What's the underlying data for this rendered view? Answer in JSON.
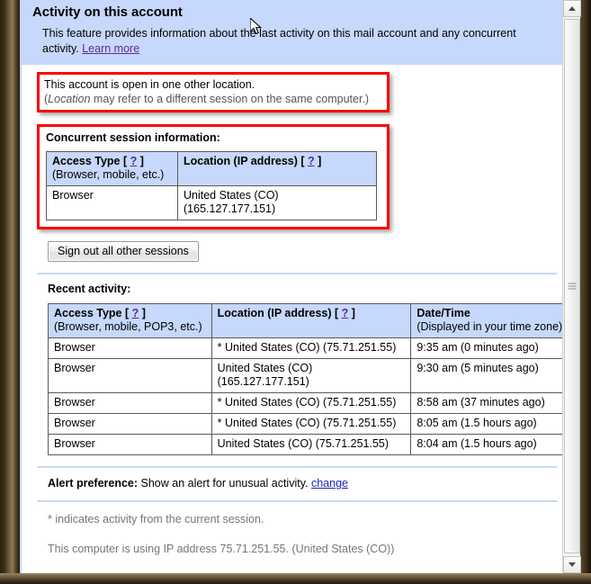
{
  "banner": {
    "title": "Activity on this account",
    "description_before_link": "This feature provides information about the last activity on this mail account and any concurrent activity. ",
    "learn_more_label": "Learn more"
  },
  "alert_box": {
    "headline": "This account is open in one other location.",
    "sub_prefix": "(",
    "sub_italic": "Location",
    "sub_rest": " may refer to a different session on the same computer.)"
  },
  "concurrent": {
    "label": "Concurrent session information:",
    "columns": [
      {
        "main": "Access Type [ ",
        "help": "?",
        "main_end": " ]",
        "sub": "(Browser, mobile, etc.)"
      },
      {
        "main": "Location (IP address) [ ",
        "help": "?",
        "main_end": " ]",
        "sub": ""
      }
    ],
    "rows": [
      {
        "access_type": "Browser",
        "location": "United States (CO) (165.127.177.151)"
      }
    ]
  },
  "signout": {
    "label": "Sign out all other sessions"
  },
  "recent": {
    "label": "Recent activity:",
    "columns": [
      {
        "main": "Access Type [ ",
        "help": "?",
        "main_end": " ]",
        "sub": "(Browser, mobile, POP3, etc.)"
      },
      {
        "main": "Location (IP address) [ ",
        "help": "?",
        "main_end": " ]",
        "sub": ""
      },
      {
        "main": "Date/Time",
        "help": "",
        "main_end": "",
        "sub": "(Displayed in your time zone)"
      }
    ],
    "rows": [
      {
        "access_type": "Browser",
        "location": "* United States (CO) (75.71.251.55)",
        "datetime": "9:35 am (0 minutes ago)"
      },
      {
        "access_type": "Browser",
        "location": "United States (CO) (165.127.177.151)",
        "datetime": "9:30 am (5 minutes ago)"
      },
      {
        "access_type": "Browser",
        "location": "* United States (CO) (75.71.251.55)",
        "datetime": "8:58 am (37 minutes ago)"
      },
      {
        "access_type": "Browser",
        "location": "* United States (CO) (75.71.251.55)",
        "datetime": "8:05 am (1.5 hours ago)"
      },
      {
        "access_type": "Browser",
        "location": "United States (CO) (75.71.251.55)",
        "datetime": "8:04 am (1.5 hours ago)"
      }
    ]
  },
  "alert_preference": {
    "label": "Alert preference:",
    "value": " Show an alert for unusual activity. ",
    "change_label": "change"
  },
  "footnotes": {
    "asterisk_note": "* indicates activity from the current session.",
    "ip_note": "This computer is using IP address 75.71.251.55. (United States (CO))"
  },
  "colors": {
    "banner_bg": "#c6d8fb",
    "table_header_bg": "#c6d8fb",
    "annotation_red": "#fa0505",
    "link_visited": "#5d2a8f",
    "link_blue": "#1a24b8",
    "muted_text": "#767676",
    "divider": "#c6d8ef"
  }
}
